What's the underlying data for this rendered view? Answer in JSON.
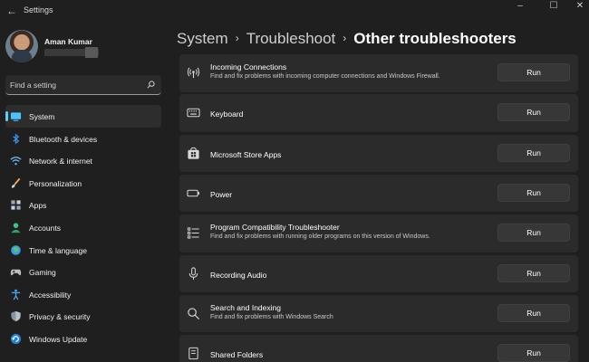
{
  "window": {
    "title": "Settings",
    "back_glyph": "←",
    "minimize_glyph": "–",
    "maximize_glyph": "☐",
    "close_glyph": "✕"
  },
  "profile": {
    "name": "Aman Kumar"
  },
  "search": {
    "placeholder": "Find a setting",
    "icon": "search-icon"
  },
  "sidebar": {
    "accent_color": "#60cdff",
    "items": [
      {
        "label": "System",
        "icon": "system-icon",
        "active": true
      },
      {
        "label": "Bluetooth & devices",
        "icon": "bluetooth-icon"
      },
      {
        "label": "Network & internet",
        "icon": "wifi-icon"
      },
      {
        "label": "Personalization",
        "icon": "brush-icon"
      },
      {
        "label": "Apps",
        "icon": "apps-icon"
      },
      {
        "label": "Accounts",
        "icon": "accounts-icon"
      },
      {
        "label": "Time & language",
        "icon": "globe-icon"
      },
      {
        "label": "Gaming",
        "icon": "gamepad-icon"
      },
      {
        "label": "Accessibility",
        "icon": "accessibility-icon"
      },
      {
        "label": "Privacy & security",
        "icon": "shield-icon"
      },
      {
        "label": "Windows Update",
        "icon": "update-icon"
      }
    ]
  },
  "breadcrumb": {
    "items": [
      "System",
      "Troubleshoot"
    ],
    "current": "Other troubleshooters",
    "separator": "›"
  },
  "troubleshooters": [
    {
      "title": "Incoming Connections",
      "description": "Find and fix problems with incoming computer connections and Windows Firewall.",
      "icon": "antenna-icon",
      "button": "Run"
    },
    {
      "title": "Keyboard",
      "description": "",
      "icon": "keyboard-icon",
      "button": "Run"
    },
    {
      "title": "Microsoft Store Apps",
      "description": "",
      "icon": "store-icon",
      "button": "Run"
    },
    {
      "title": "Power",
      "description": "",
      "icon": "battery-icon",
      "button": "Run"
    },
    {
      "title": "Program Compatibility Troubleshooter",
      "description": "Find and fix problems with running older programs on this version of Windows.",
      "icon": "list-icon",
      "button": "Run"
    },
    {
      "title": "Recording Audio",
      "description": "",
      "icon": "microphone-icon",
      "button": "Run"
    },
    {
      "title": "Search and Indexing",
      "description": "Find and fix problems with Windows Search",
      "icon": "search-icon",
      "button": "Run"
    },
    {
      "title": "Shared Folders",
      "description": "",
      "icon": "folder-icon",
      "button": "Run"
    }
  ]
}
